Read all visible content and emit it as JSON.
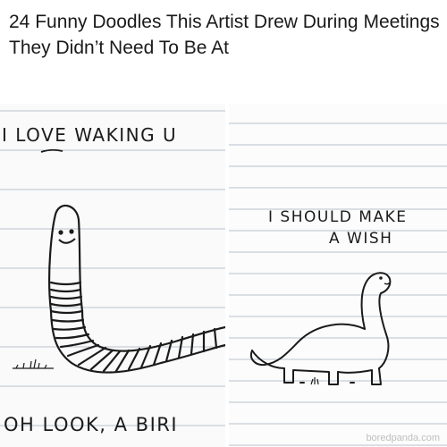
{
  "headline": "24 Funny Doodles This Artist Drew During Meetings They Didn’t Need To Be At",
  "panels": {
    "left": {
      "top_caption": "I LOVE WAKING U",
      "bottom_caption": "OH LOOK, A BIRI",
      "illustration": "smiling-worm-doodle"
    },
    "right": {
      "caption_line1": "I SHOULD MAKE",
      "caption_line2": "A WISH",
      "illustration": "dinosaur-doodle",
      "watermark": "boredpanda.com"
    }
  },
  "colors": {
    "ink": "#1b1b1b",
    "ruled_line": "#b9c2cc",
    "paper": "#fafafa"
  }
}
